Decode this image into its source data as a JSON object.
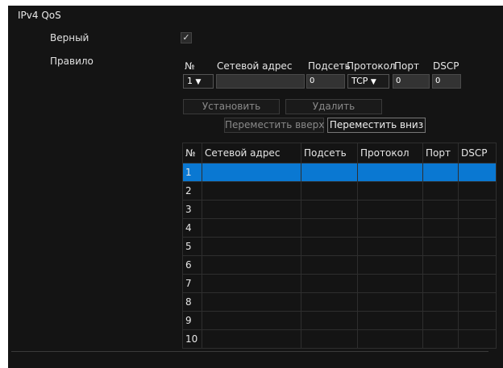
{
  "section_title": "IPv4 QoS",
  "enabled_label": "Верный",
  "enabled_checked": true,
  "rule_label": "Правило",
  "columns": {
    "no": "№",
    "network_address": "Сетевой адрес",
    "subnet": "Подсеть",
    "protocol": "Протокол",
    "port": "Порт",
    "dscp": "DSCP"
  },
  "rule_form": {
    "no_value": "1",
    "network_address_value": "",
    "subnet_value": "0",
    "protocol_value": "TCP",
    "port_value": "0",
    "dscp_value": "0"
  },
  "buttons": {
    "set": "Установить",
    "delete": "Удалить",
    "move_up": "Переместить вверх",
    "move_down": "Переместить вниз"
  },
  "table": {
    "headers": [
      "№",
      "Сетевой адрес",
      "Подсеть",
      "Протокол",
      "Порт",
      "DSCP"
    ],
    "rows": [
      "1",
      "2",
      "3",
      "4",
      "5",
      "6",
      "7",
      "8",
      "9",
      "10"
    ],
    "selected_row": 1
  },
  "colors": {
    "background": "#141414",
    "selected_row": "#0a78d2"
  }
}
